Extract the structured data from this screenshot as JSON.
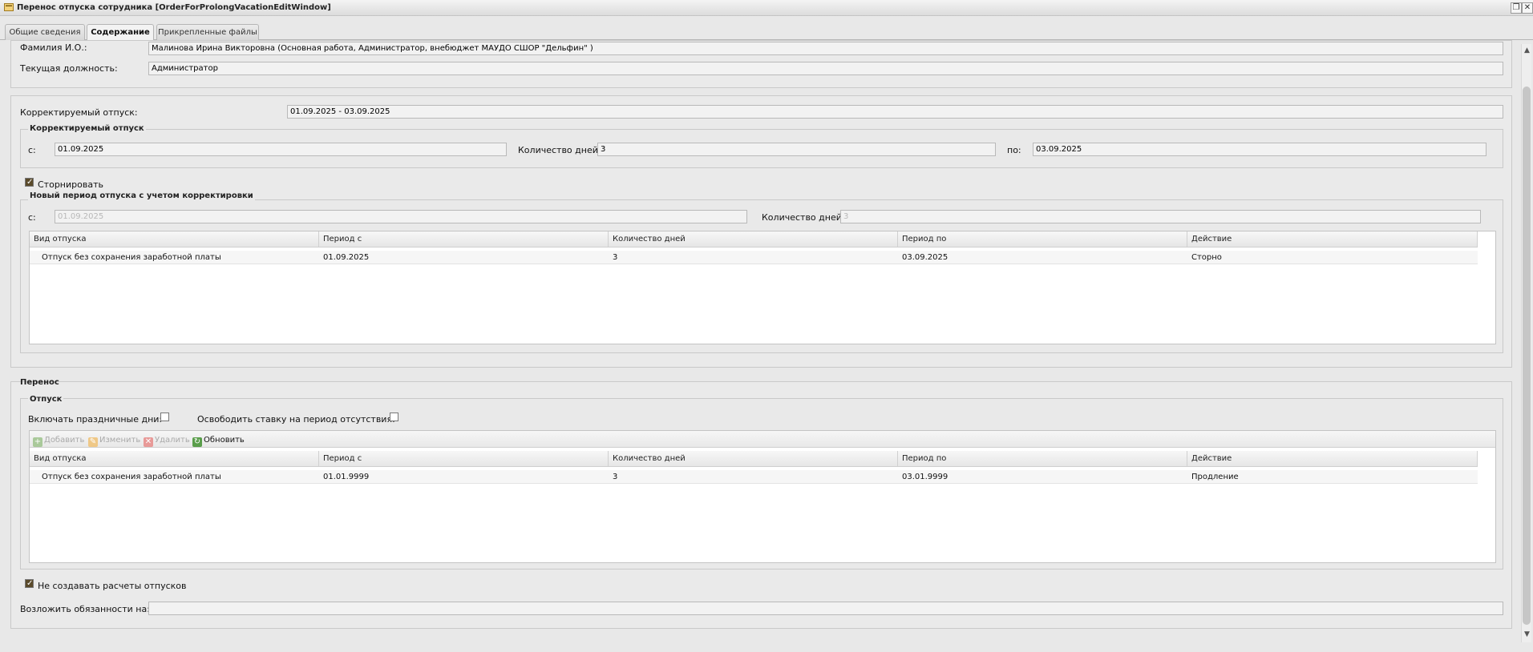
{
  "window": {
    "title": "Перенос отпуска сотрудника [OrderForProlongVacationEditWindow]",
    "restore_glyph": "❐",
    "close_glyph": "✕"
  },
  "tabs": [
    {
      "label": "Общие сведения",
      "active": false
    },
    {
      "label": "Содержание",
      "active": true
    },
    {
      "label": "Прикрепленные файлы",
      "active": false
    }
  ],
  "employee": {
    "fio_label": "Фамилия И.О.:",
    "fio_value": "Малинова Ирина Викторовна (Основная работа, Администратор, внебюджет МАУДО СШОР \"Дельфин\" )",
    "position_label": "Текущая должность:",
    "position_value": "Администратор"
  },
  "corrected": {
    "label": "Корректируемый отпуск:",
    "value": "01.09.2025 - 03.09.2025",
    "fieldset_title": "Корректируемый отпуск",
    "from_label": "с:",
    "from_value": "01.09.2025",
    "days_label": "Количество дней:",
    "days_value": "3",
    "to_label": "по:",
    "to_value": "03.09.2025",
    "storno_label": "Сторнировать",
    "storno_checked": true
  },
  "new_period": {
    "fieldset_title": "Новый период отпуска с учетом корректировки",
    "from_label": "с:",
    "from_value": "01.09.2025",
    "days_label": "Количество дней:",
    "days_value": "3",
    "columns": [
      "Вид отпуска",
      "Период с",
      "Количество дней",
      "Период по",
      "Действие"
    ],
    "rows": [
      [
        "Отпуск без сохранения заработной платы",
        "01.09.2025",
        "3",
        "03.09.2025",
        "Сторно"
      ]
    ]
  },
  "transfer": {
    "section_title": "Перенос",
    "fieldset_title": "Отпуск",
    "holidays_label": "Включать праздничные дни:",
    "holidays_checked": false,
    "free_rate_label": "Освободить ставку на период отсутствия:",
    "free_rate_checked": false,
    "toolbar": {
      "add": "Добавить",
      "edit": "Изменить",
      "delete": "Удалить",
      "refresh": "Обновить"
    },
    "columns": [
      "Вид отпуска",
      "Период с",
      "Количество дней",
      "Период по",
      "Действие"
    ],
    "rows": [
      [
        "Отпуск без сохранения заработной платы",
        "01.01.9999",
        "3",
        "03.01.9999",
        "Продление"
      ]
    ]
  },
  "no_calc_label": "Не создавать расчеты отпусков",
  "no_calc_checked": true,
  "delegate_label": "Возложить обязанности на:",
  "delegate_value": "",
  "scrollbar": {
    "up_glyph": "▲",
    "down_glyph": "▼"
  },
  "colors": {
    "accent_check": "#5a4a2a",
    "add_icon": "#6aa84f",
    "edit_icon": "#e6a23c",
    "delete_icon": "#d9534f",
    "refresh_icon": "#5a9e4b"
  }
}
